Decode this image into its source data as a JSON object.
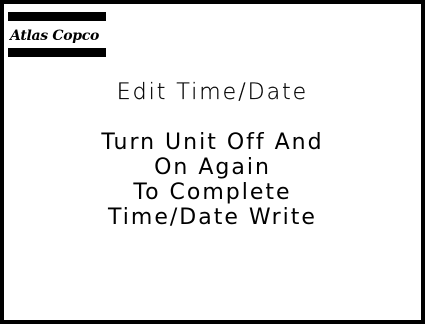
{
  "logo": {
    "brand": "Atlas Copco"
  },
  "screen": {
    "title": "Edit Time/Date",
    "message_lines": [
      "Turn Unit Off And",
      "On Again",
      "To Complete",
      "Time/Date Write"
    ]
  },
  "colors": {
    "background": "#ffffff",
    "foreground": "#000000"
  }
}
